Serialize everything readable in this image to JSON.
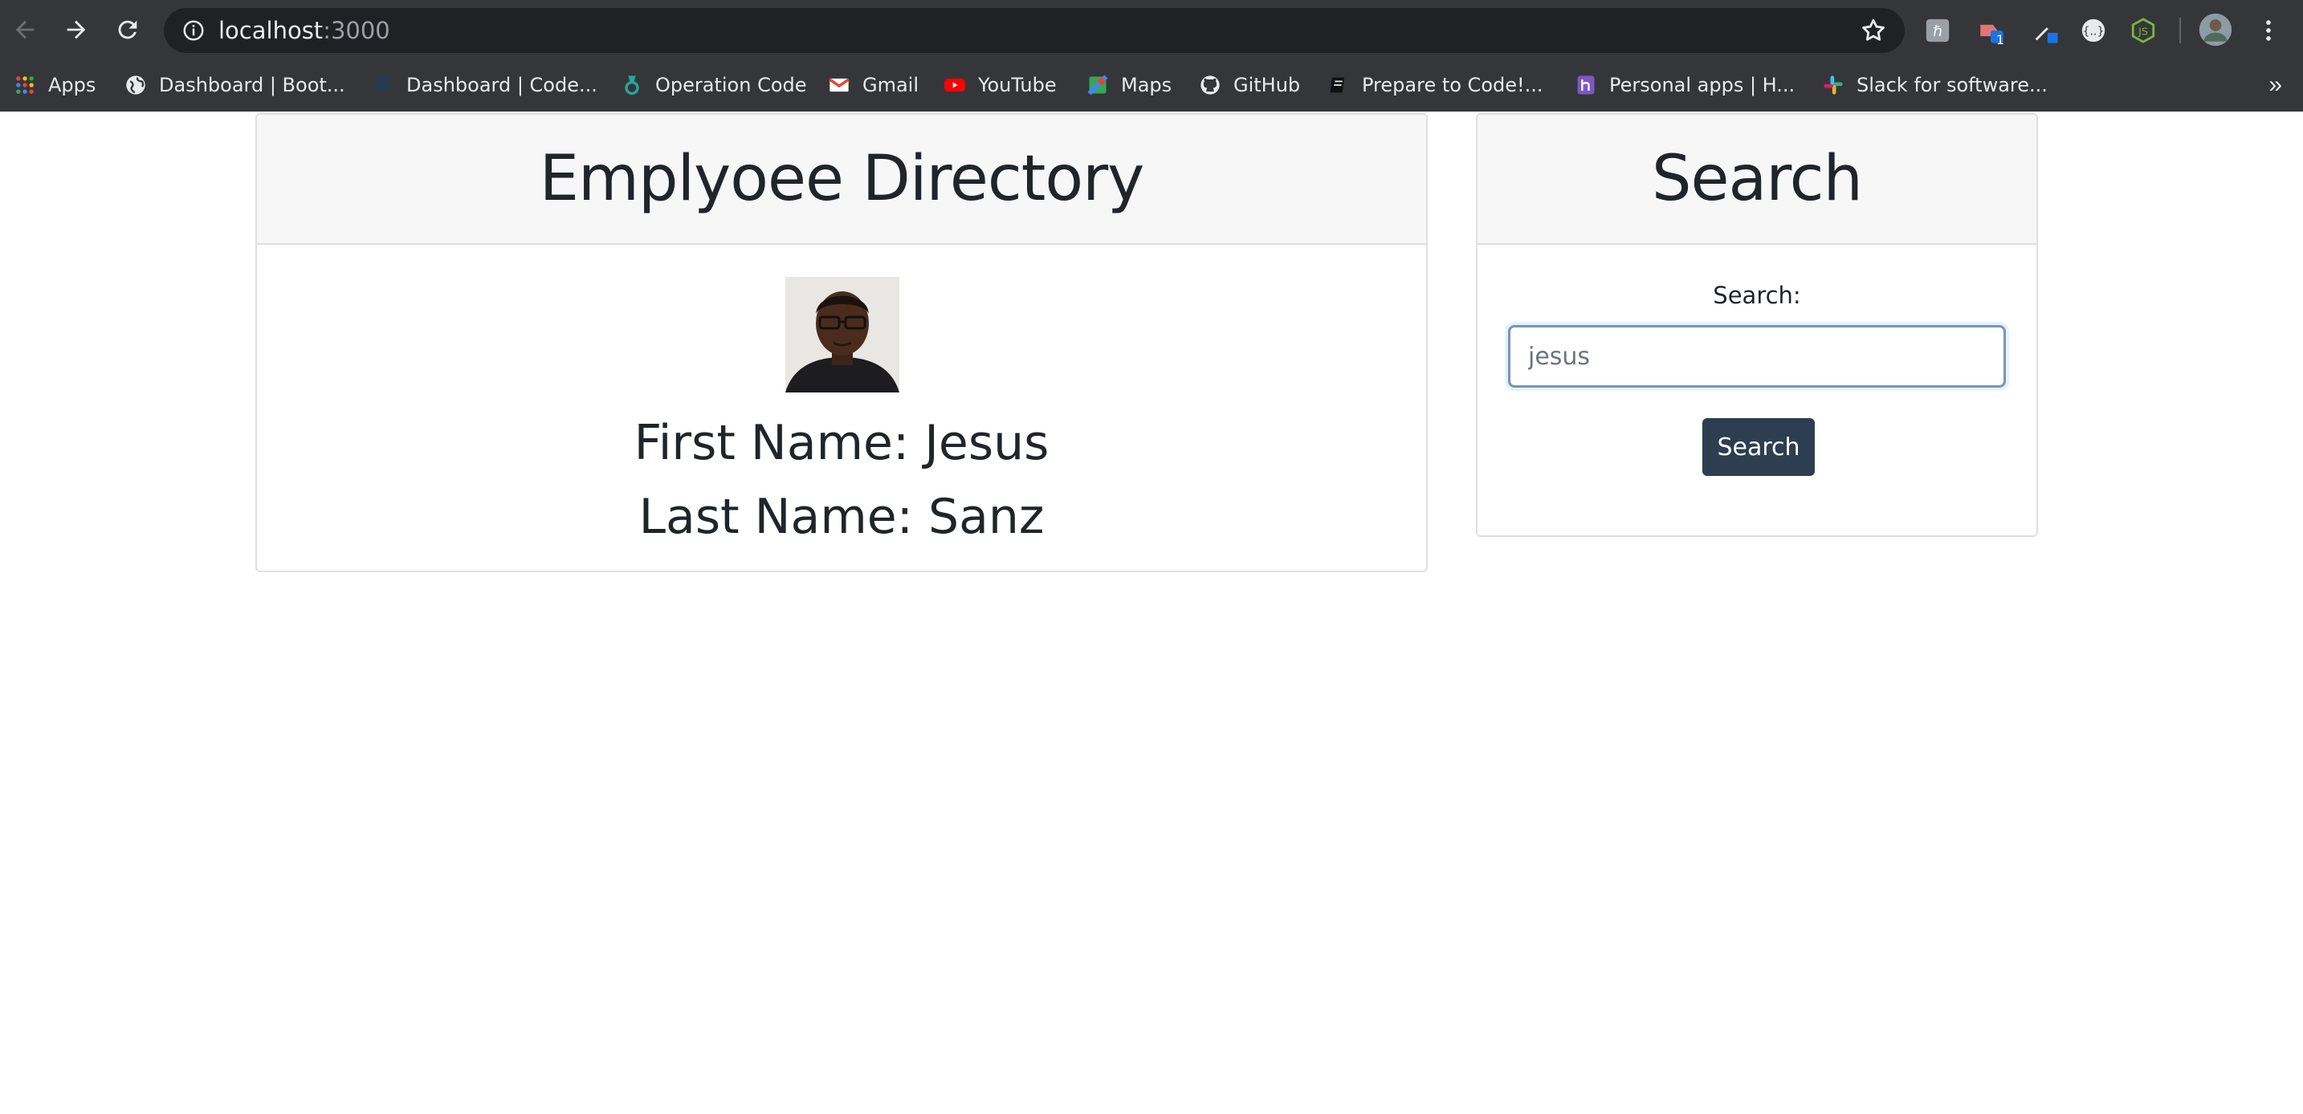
{
  "browser": {
    "url_host": "localhost",
    "url_port": ":3000",
    "bookmarks": [
      {
        "label": "Apps",
        "icon": "apps-grid-icon"
      },
      {
        "label": "Dashboard | Boot...",
        "icon": "globe-icon"
      },
      {
        "label": "Dashboard | Code...",
        "icon": "page-icon"
      },
      {
        "label": "Operation Code",
        "icon": "operation-code-icon"
      },
      {
        "label": "Gmail",
        "icon": "gmail-icon"
      },
      {
        "label": "YouTube",
        "icon": "youtube-icon"
      },
      {
        "label": "Maps",
        "icon": "maps-icon"
      },
      {
        "label": "GitHub",
        "icon": "github-icon"
      },
      {
        "label": "Prepare to Code!...",
        "icon": "book-icon"
      },
      {
        "label": "Personal apps | H...",
        "icon": "heroku-icon"
      },
      {
        "label": "Slack for software...",
        "icon": "slack-icon"
      }
    ],
    "more_bookmarks": "»",
    "extension_badge": "1"
  },
  "directory": {
    "title": "Emplyoee Directory",
    "first_name_line": "First Name: Jesus",
    "last_name_line": "Last Name: Sanz"
  },
  "search": {
    "title": "Search",
    "label": "Search:",
    "input_value": "jesus",
    "button_label": "Search"
  },
  "colors": {
    "chrome_bg": "#35363a",
    "omnibox_bg": "#202124",
    "button_bg": "#2c3e50",
    "card_header_bg": "#f7f7f7"
  }
}
